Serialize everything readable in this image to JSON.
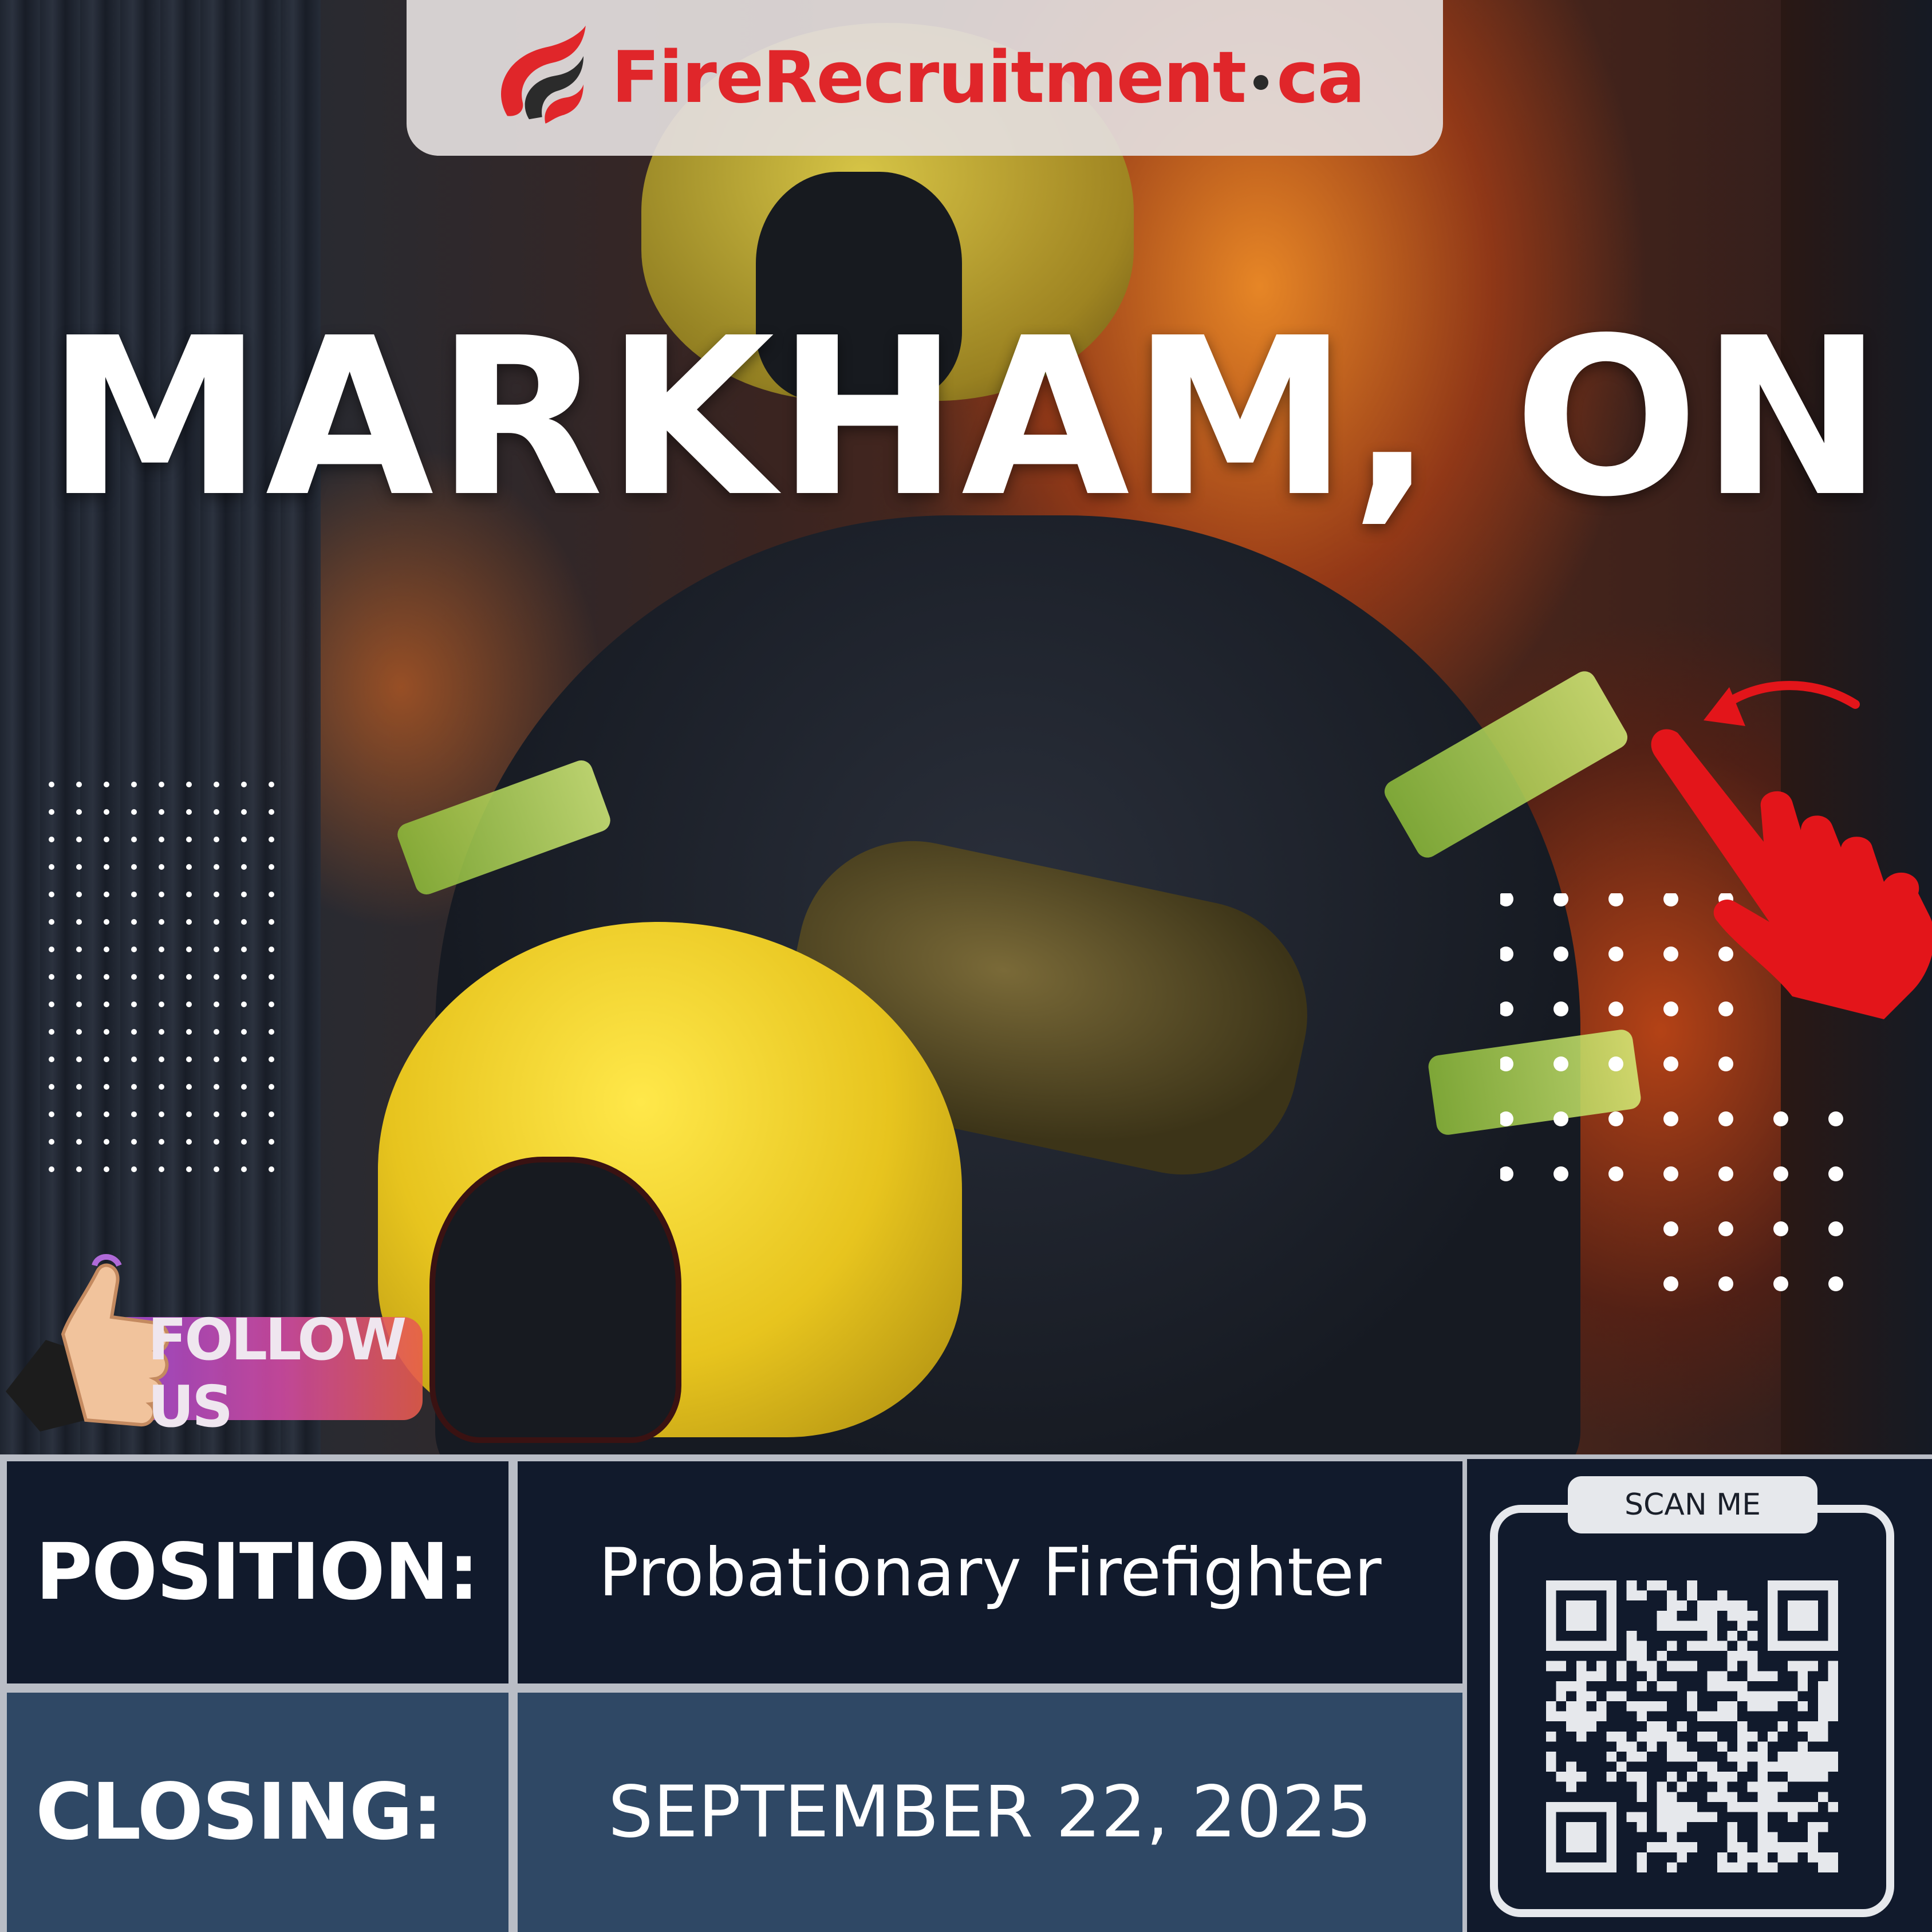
{
  "logo": {
    "text_main": "FireRecruitment",
    "text_tld": "ca",
    "icon": "flame-logo-icon",
    "color": "#e0262a"
  },
  "city": "MARKHAM, ON",
  "follow_badge": {
    "label": "FOLLOW US",
    "icon": "thumbs-up-icon"
  },
  "pointer": {
    "icon": "pointing-hand-icon",
    "arrow": "curved-arrow-icon",
    "color": "#e3151a"
  },
  "info": {
    "position_label": "POSITION:",
    "position_value": "Probationary Firefighter",
    "closing_label": "CLOSING:",
    "closing_value": "SEPTEMBER 22, 2025"
  },
  "qr": {
    "tab_label": "SCAN ME",
    "icon": "qr-code-icon"
  },
  "colors": {
    "navy": "#111a2c",
    "steel": "#2f4865",
    "accent_red": "#e0262a"
  }
}
